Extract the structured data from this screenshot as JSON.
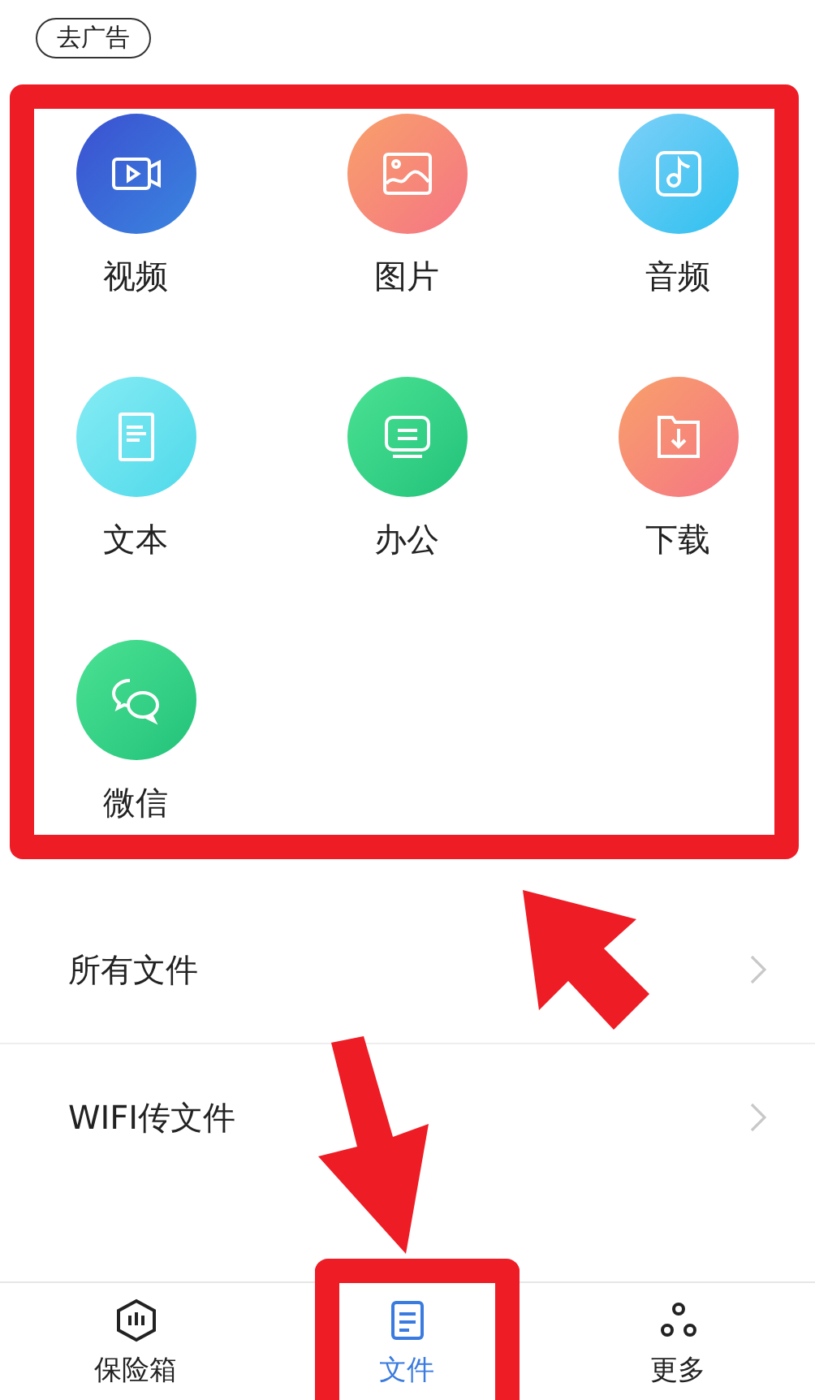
{
  "ad_button": {
    "label": "去广告"
  },
  "categories": [
    {
      "label": "视频",
      "kind": "video"
    },
    {
      "label": "图片",
      "kind": "image"
    },
    {
      "label": "音频",
      "kind": "audio"
    },
    {
      "label": "文本",
      "kind": "text"
    },
    {
      "label": "办公",
      "kind": "office"
    },
    {
      "label": "下载",
      "kind": "download"
    },
    {
      "label": "微信",
      "kind": "wechat"
    }
  ],
  "list": [
    {
      "label": "所有文件"
    },
    {
      "label": "WIFI传文件"
    }
  ],
  "bottom_nav": [
    {
      "label": "保险箱",
      "kind": "vault",
      "selected": false
    },
    {
      "label": "文件",
      "kind": "files",
      "selected": true
    },
    {
      "label": "更多",
      "kind": "more",
      "selected": false
    }
  ]
}
